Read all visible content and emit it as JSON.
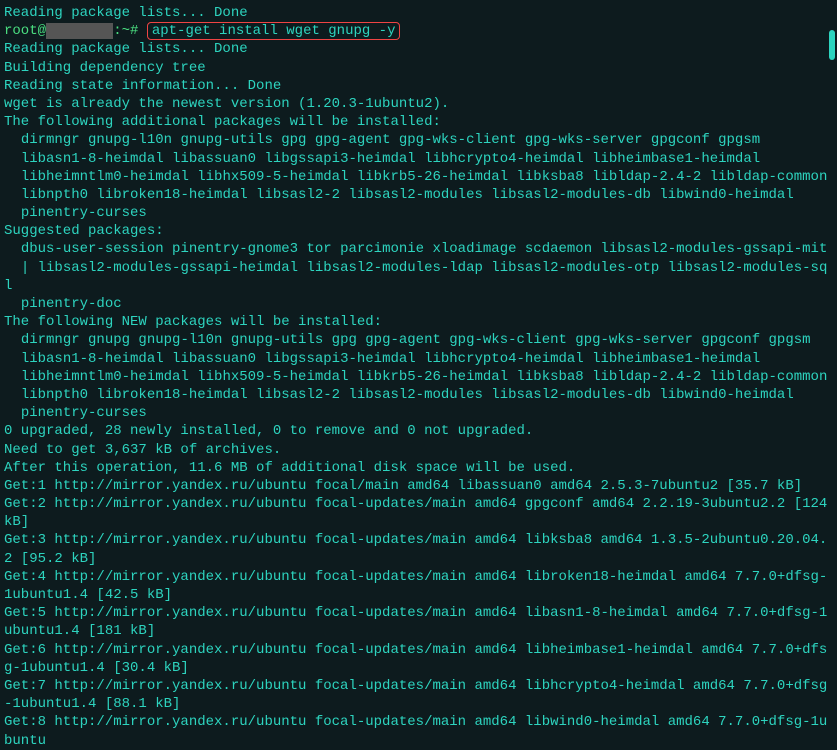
{
  "lines": [
    {
      "type": "cyan",
      "text": "Reading package lists... Done"
    },
    {
      "type": "prompt",
      "user": "root@",
      "host_redacted": "        ",
      "suffix": ":~# ",
      "command": "apt-get install wget gnupg -y"
    },
    {
      "type": "cyan",
      "text": "Reading package lists... Done"
    },
    {
      "type": "cyan",
      "text": "Building dependency tree"
    },
    {
      "type": "cyan",
      "text": "Reading state information... Done"
    },
    {
      "type": "cyan",
      "text": "wget is already the newest version (1.20.3-1ubuntu2)."
    },
    {
      "type": "cyan",
      "text": "The following additional packages will be installed:"
    },
    {
      "type": "cyan",
      "text": "  dirmngr gnupg-l10n gnupg-utils gpg gpg-agent gpg-wks-client gpg-wks-server gpgconf gpgsm"
    },
    {
      "type": "cyan",
      "text": "  libasn1-8-heimdal libassuan0 libgssapi3-heimdal libhcrypto4-heimdal libheimbase1-heimdal"
    },
    {
      "type": "cyan",
      "text": "  libheimntlm0-heimdal libhx509-5-heimdal libkrb5-26-heimdal libksba8 libldap-2.4-2 libldap-common"
    },
    {
      "type": "cyan",
      "text": "  libnpth0 libroken18-heimdal libsasl2-2 libsasl2-modules libsasl2-modules-db libwind0-heimdal"
    },
    {
      "type": "cyan",
      "text": "  pinentry-curses"
    },
    {
      "type": "cyan",
      "text": "Suggested packages:"
    },
    {
      "type": "cyan",
      "text": "  dbus-user-session pinentry-gnome3 tor parcimonie xloadimage scdaemon libsasl2-modules-gssapi-mit"
    },
    {
      "type": "cyan",
      "text": "  | libsasl2-modules-gssapi-heimdal libsasl2-modules-ldap libsasl2-modules-otp libsasl2-modules-sql"
    },
    {
      "type": "cyan",
      "text": "  pinentry-doc"
    },
    {
      "type": "cyan",
      "text": "The following NEW packages will be installed:"
    },
    {
      "type": "cyan",
      "text": "  dirmngr gnupg gnupg-l10n gnupg-utils gpg gpg-agent gpg-wks-client gpg-wks-server gpgconf gpgsm"
    },
    {
      "type": "cyan",
      "text": "  libasn1-8-heimdal libassuan0 libgssapi3-heimdal libhcrypto4-heimdal libheimbase1-heimdal"
    },
    {
      "type": "cyan",
      "text": "  libheimntlm0-heimdal libhx509-5-heimdal libkrb5-26-heimdal libksba8 libldap-2.4-2 libldap-common"
    },
    {
      "type": "cyan",
      "text": "  libnpth0 libroken18-heimdal libsasl2-2 libsasl2-modules libsasl2-modules-db libwind0-heimdal"
    },
    {
      "type": "cyan",
      "text": "  pinentry-curses"
    },
    {
      "type": "cyan",
      "text": "0 upgraded, 28 newly installed, 0 to remove and 0 not upgraded."
    },
    {
      "type": "cyan",
      "text": "Need to get 3,637 kB of archives."
    },
    {
      "type": "cyan",
      "text": "After this operation, 11.6 MB of additional disk space will be used."
    },
    {
      "type": "cyan",
      "text": "Get:1 http://mirror.yandex.ru/ubuntu focal/main amd64 libassuan0 amd64 2.5.3-7ubuntu2 [35.7 kB]"
    },
    {
      "type": "cyan",
      "text": "Get:2 http://mirror.yandex.ru/ubuntu focal-updates/main amd64 gpgconf amd64 2.2.19-3ubuntu2.2 [124 kB]"
    },
    {
      "type": "cyan",
      "text": "Get:3 http://mirror.yandex.ru/ubuntu focal-updates/main amd64 libksba8 amd64 1.3.5-2ubuntu0.20.04.2 [95.2 kB]"
    },
    {
      "type": "cyan",
      "text": "Get:4 http://mirror.yandex.ru/ubuntu focal-updates/main amd64 libroken18-heimdal amd64 7.7.0+dfsg-1ubuntu1.4 [42.5 kB]"
    },
    {
      "type": "cyan",
      "text": "Get:5 http://mirror.yandex.ru/ubuntu focal-updates/main amd64 libasn1-8-heimdal amd64 7.7.0+dfsg-1ubuntu1.4 [181 kB]"
    },
    {
      "type": "cyan",
      "text": "Get:6 http://mirror.yandex.ru/ubuntu focal-updates/main amd64 libheimbase1-heimdal amd64 7.7.0+dfsg-1ubuntu1.4 [30.4 kB]"
    },
    {
      "type": "cyan",
      "text": "Get:7 http://mirror.yandex.ru/ubuntu focal-updates/main amd64 libhcrypto4-heimdal amd64 7.7.0+dfsg-1ubuntu1.4 [88.1 kB]"
    },
    {
      "type": "cyan",
      "text": "Get:8 http://mirror.yandex.ru/ubuntu focal-updates/main amd64 libwind0-heimdal amd64 7.7.0+dfsg-1ubuntu"
    }
  ]
}
